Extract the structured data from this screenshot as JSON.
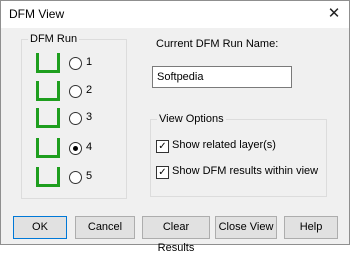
{
  "window": {
    "title": "DFM View",
    "close_glyph": "✕"
  },
  "dfm_run": {
    "group_label": "DFM Run",
    "selected": "4",
    "runs": [
      {
        "label": "1"
      },
      {
        "label": "2"
      },
      {
        "label": "3"
      },
      {
        "label": "4"
      },
      {
        "label": "5"
      }
    ],
    "icon_color": "#1e9e1e"
  },
  "current_run_name": {
    "label": "Current DFM Run Name:",
    "value": "Softpedia"
  },
  "view_options": {
    "group_label": "View Options",
    "show_related_layers": {
      "label": "Show related layer(s)",
      "checked": true
    },
    "show_dfm_results": {
      "label": "Show DFM results within view",
      "checked": true
    }
  },
  "buttons": {
    "ok": "OK",
    "cancel": "Cancel",
    "clear_results": "Clear Results",
    "close_view": "Close View",
    "help": "Help"
  }
}
